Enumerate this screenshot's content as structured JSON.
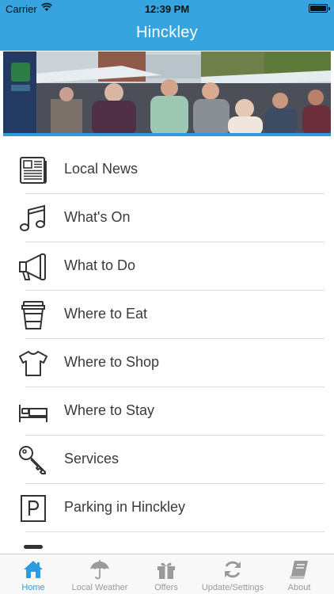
{
  "status_bar": {
    "carrier": "Carrier",
    "time": "12:39 PM"
  },
  "header": {
    "title": "Hinckley"
  },
  "menu": {
    "items": [
      {
        "label": "Local News",
        "icon": "newspaper-icon"
      },
      {
        "label": "What's On",
        "icon": "music-note-icon"
      },
      {
        "label": "What to Do",
        "icon": "megaphone-icon"
      },
      {
        "label": "Where to Eat",
        "icon": "coffee-cup-icon"
      },
      {
        "label": "Where to Shop",
        "icon": "tshirt-icon"
      },
      {
        "label": "Where to Stay",
        "icon": "bed-icon"
      },
      {
        "label": "Services",
        "icon": "key-icon"
      },
      {
        "label": "Parking in Hinckley",
        "icon": "parking-icon"
      }
    ]
  },
  "tabbar": {
    "tabs": [
      {
        "label": "Home",
        "icon": "home-icon",
        "active": true
      },
      {
        "label": "Local Weather",
        "icon": "umbrella-icon",
        "active": false
      },
      {
        "label": "Offers",
        "icon": "gift-icon",
        "active": false
      },
      {
        "label": "Update/Settings",
        "icon": "refresh-icon",
        "active": false
      },
      {
        "label": "About",
        "icon": "book-icon",
        "active": false
      }
    ]
  },
  "colors": {
    "accent": "#36a5df",
    "tab_active": "#2e9be0",
    "tab_inactive": "#9a9a9a"
  }
}
